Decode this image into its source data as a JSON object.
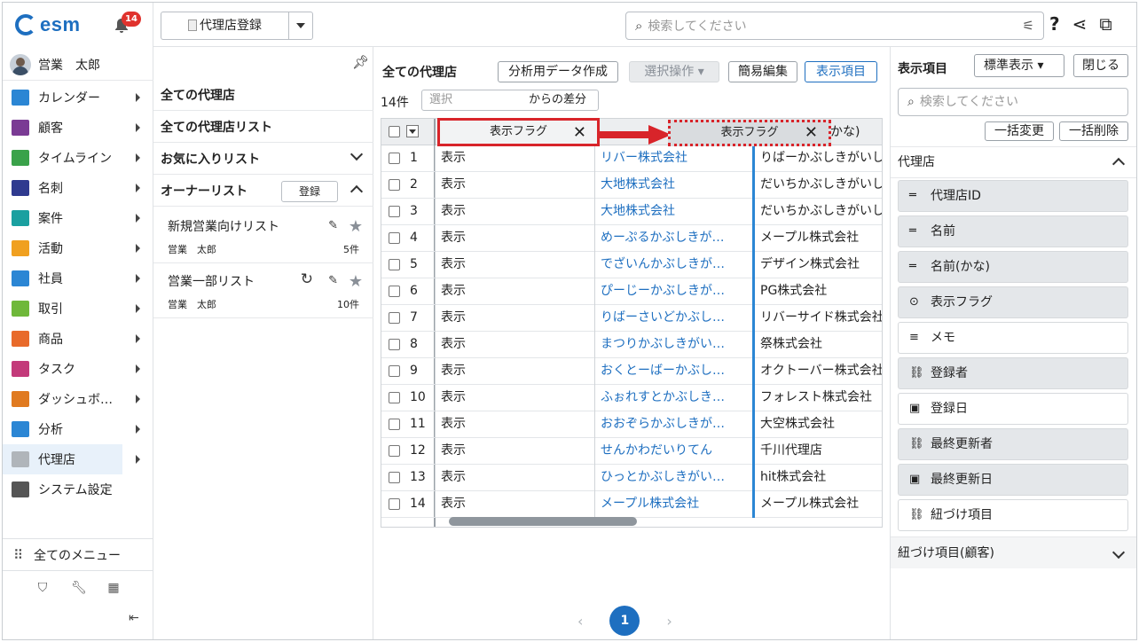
{
  "app": {
    "logo": "esm",
    "notifications": "14",
    "user": "営業　太郎"
  },
  "nav": {
    "items": [
      {
        "label": "カレンダー",
        "color": "#2b86d4"
      },
      {
        "label": "顧客",
        "color": "#7a3b94"
      },
      {
        "label": "タイムライン",
        "color": "#3aa24a"
      },
      {
        "label": "名刺",
        "color": "#2f3a8f"
      },
      {
        "label": "案件",
        "color": "#1aa0a0"
      },
      {
        "label": "活動",
        "color": "#f0a020"
      },
      {
        "label": "社員",
        "color": "#2b86d4"
      },
      {
        "label": "取引",
        "color": "#6fb83a"
      },
      {
        "label": "商品",
        "color": "#e86a2a"
      },
      {
        "label": "タスク",
        "color": "#c33a7a"
      },
      {
        "label": "ダッシュボ…",
        "color": "#e07a20"
      },
      {
        "label": "分析",
        "color": "#2b86d4"
      },
      {
        "label": "代理店",
        "color": "#b0b5ba"
      },
      {
        "label": "システム設定",
        "color": "#555"
      }
    ],
    "all_menu": "全てのメニュー"
  },
  "topbar": {
    "register_btn": "代理店登録",
    "search_placeholder": "検索してください"
  },
  "lists": {
    "all_agencies": "全ての代理店",
    "all_lists": "全ての代理店リスト",
    "favorites": "お気に入りリスト",
    "owner": "オーナーリスト",
    "register": "登録",
    "cards": [
      {
        "title": "新規営業向けリスト",
        "owner": "営業　太郎",
        "count": "5件"
      },
      {
        "title": "営業一部リスト",
        "owner": "営業　太郎",
        "count": "10件"
      }
    ]
  },
  "main": {
    "title": "全ての代理店",
    "btn_analysis": "分析用データ作成",
    "btn_select": "選択操作",
    "btn_quick": "簡易編集",
    "btn_display": "表示項目",
    "count": "14件",
    "select_placeholder": "選択",
    "diff": "からの差分",
    "col_flag": "表示フラグ",
    "drag_label": "表示フラグ",
    "col_kana_tail": "かな)",
    "rows": [
      {
        "no": "1",
        "flag": "表示",
        "name": "リバー株式会社",
        "kana": "りばーかぶしきがいし"
      },
      {
        "no": "2",
        "flag": "表示",
        "name": "大地株式会社",
        "kana": "だいちかぶしきがいし"
      },
      {
        "no": "3",
        "flag": "表示",
        "name": "大地株式会社",
        "kana": "だいちかぶしきがいし"
      },
      {
        "no": "4",
        "flag": "表示",
        "name": "めーぷるかぶしきが…",
        "kana": "メープル株式会社"
      },
      {
        "no": "5",
        "flag": "表示",
        "name": "でざいんかぶしきが…",
        "kana": "デザイン株式会社"
      },
      {
        "no": "6",
        "flag": "表示",
        "name": "ぴーじーかぶしきが…",
        "kana": "PG株式会社"
      },
      {
        "no": "7",
        "flag": "表示",
        "name": "りばーさいどかぶし…",
        "kana": "リバーサイド株式会社"
      },
      {
        "no": "8",
        "flag": "表示",
        "name": "まつりかぶしきがい…",
        "kana": "祭株式会社"
      },
      {
        "no": "9",
        "flag": "表示",
        "name": "おくとーばーかぶし…",
        "kana": "オクトーバー株式会社"
      },
      {
        "no": "10",
        "flag": "表示",
        "name": "ふぉれすとかぶしき…",
        "kana": "フォレスト株式会社"
      },
      {
        "no": "11",
        "flag": "表示",
        "name": "おおぞらかぶしきが…",
        "kana": "大空株式会社"
      },
      {
        "no": "12",
        "flag": "表示",
        "name": "せんかわだいりてん",
        "kana": "千川代理店"
      },
      {
        "no": "13",
        "flag": "表示",
        "name": "ひっとかぶしきがい…",
        "kana": "hit株式会社"
      },
      {
        "no": "14",
        "flag": "表示",
        "name": "メープル株式会社",
        "kana": "メープル株式会社"
      }
    ],
    "page": "1"
  },
  "right": {
    "title": "表示項目",
    "std": "標準表示",
    "close": "閉じる",
    "search_placeholder": "検索してください",
    "bulk_change": "一括変更",
    "bulk_delete": "一括削除",
    "section": "代理店",
    "items": [
      {
        "label": "代理店ID",
        "icon": "text-icon",
        "glyph": "═",
        "bg": "gray"
      },
      {
        "label": "名前",
        "icon": "text-icon",
        "glyph": "═",
        "bg": "gray"
      },
      {
        "label": "名前(かな)",
        "icon": "text-icon",
        "glyph": "═",
        "bg": "gray"
      },
      {
        "label": "表示フラグ",
        "icon": "dropdown-icon",
        "glyph": "⊙",
        "bg": "gray"
      },
      {
        "label": "メモ",
        "icon": "multiline-icon",
        "glyph": "≡",
        "bg": "white"
      },
      {
        "label": "登録者",
        "icon": "user-link-icon",
        "glyph": "⛓",
        "bg": "gray"
      },
      {
        "label": "登録日",
        "icon": "calendar-icon",
        "glyph": "▣",
        "bg": "white"
      },
      {
        "label": "最終更新者",
        "icon": "user-link-icon",
        "glyph": "⛓",
        "bg": "gray"
      },
      {
        "label": "最終更新日",
        "icon": "calendar-icon",
        "glyph": "▣",
        "bg": "gray"
      },
      {
        "label": "紐づけ項目",
        "icon": "link-icon",
        "glyph": "⛓",
        "bg": "white"
      }
    ],
    "section2": "紐づけ項目(顧客)"
  }
}
